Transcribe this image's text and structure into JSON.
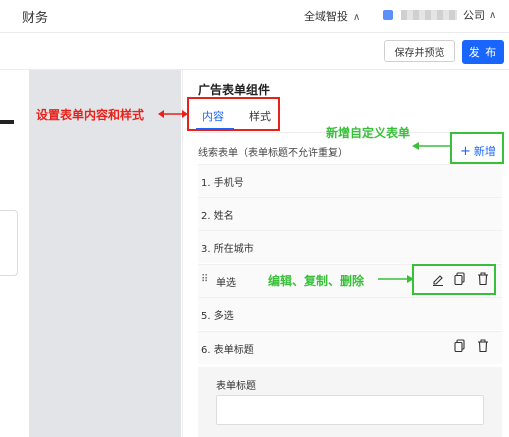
{
  "header": {
    "app_title": "财务",
    "region_label": "全域智投",
    "company_suffix": "公司"
  },
  "toolbar": {
    "preview_label": "保存并预览",
    "publish_label": "发 布"
  },
  "panel": {
    "title": "广告表单组件",
    "tabs": [
      {
        "label": "内容",
        "active": true
      },
      {
        "label": "样式",
        "active": false
      }
    ],
    "leads_label": "线索表单（表单标题不允许重复）",
    "add_label": "新增",
    "fields": [
      {
        "label": "1. 手机号"
      },
      {
        "label": "2. 姓名"
      },
      {
        "label": "3. 所在城市"
      },
      {
        "label": "单选"
      },
      {
        "label": "5. 多选"
      },
      {
        "label": "6. 表单标题"
      }
    ],
    "sub_form_label": "表单标题",
    "sub_form_value": ""
  },
  "annotations": {
    "tabs_note": "设置表单内容和样式",
    "add_note": "新增自定义表单",
    "actions_note": "编辑、复制、删除",
    "color_red": "#e8221b",
    "color_green": "#38c03a"
  },
  "icons": [
    "edit-icon",
    "copy-icon",
    "delete-icon",
    "drag-handle-icon",
    "plus-icon",
    "chevron-up-icon",
    "user-icon"
  ]
}
